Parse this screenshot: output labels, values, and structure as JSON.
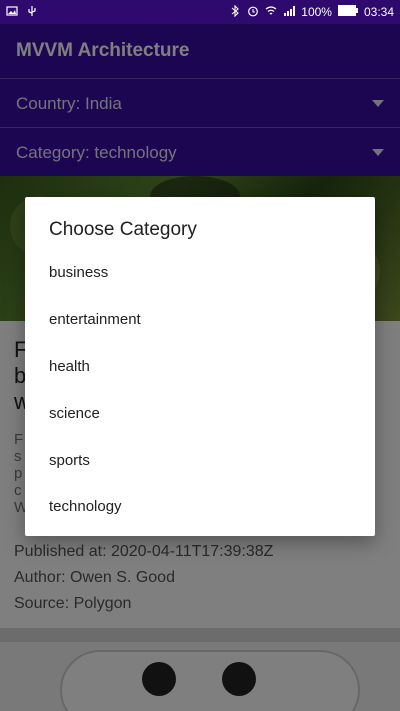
{
  "status_bar": {
    "battery_percent": "100%",
    "time": "03:34",
    "left_icons": [
      "image-icon",
      "usb-icon"
    ],
    "right_icons": [
      "bluetooth-icon",
      "alarm-icon",
      "wifi-icon",
      "signal-icon",
      "battery-icon"
    ]
  },
  "app_bar": {
    "title": "MVVM Architecture"
  },
  "spinners": {
    "country": "Country: India",
    "category": "Category: technology"
  },
  "article": {
    "headline_partial": [
      "F",
      "b",
      "w"
    ],
    "description_partial": [
      "F",
      "s",
      "p",
      "c",
      "W"
    ],
    "published": "Published at: 2020-04-11T17:39:38Z",
    "author": "Author: Owen S. Good",
    "source": "Source: Polygon"
  },
  "dialog": {
    "title": "Choose Category",
    "options": [
      "business",
      "entertainment",
      "health",
      "science",
      "sports",
      "technology"
    ]
  },
  "colors": {
    "primary": "#3a0ca3",
    "status_bar": "#2e0a6e"
  }
}
